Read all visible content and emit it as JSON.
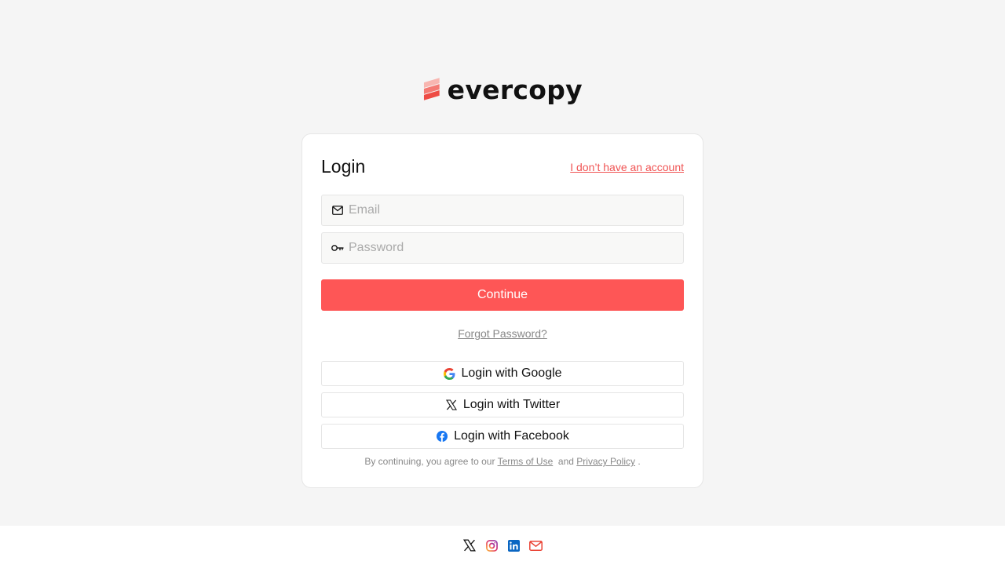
{
  "brand": {
    "name": "evercopy",
    "accent_color": "#fe5656",
    "logo_icon": "evercopy-logo-mark"
  },
  "login": {
    "title": "Login",
    "signup_link": "I don’t have an account",
    "email": {
      "icon": "mail-icon",
      "placeholder": "Email",
      "value": ""
    },
    "password": {
      "icon": "key-icon",
      "placeholder": "Password",
      "value": ""
    },
    "continue_label": "Continue",
    "forgot_label": "Forgot Password?",
    "social": [
      {
        "icon": "google-icon",
        "label": "Login with Google"
      },
      {
        "icon": "x-twitter-icon",
        "label": "Login with Twitter"
      },
      {
        "icon": "facebook-icon",
        "label": "Login with Facebook"
      }
    ],
    "terms": {
      "prefix": "By continuing, you agree to our",
      "terms_label": "Terms of Use",
      "and": "and",
      "privacy_label": "Privacy Policy",
      "suffix": "."
    }
  },
  "footer": {
    "icons": [
      "x-twitter-icon",
      "instagram-icon",
      "linkedin-icon",
      "mail-icon"
    ]
  }
}
